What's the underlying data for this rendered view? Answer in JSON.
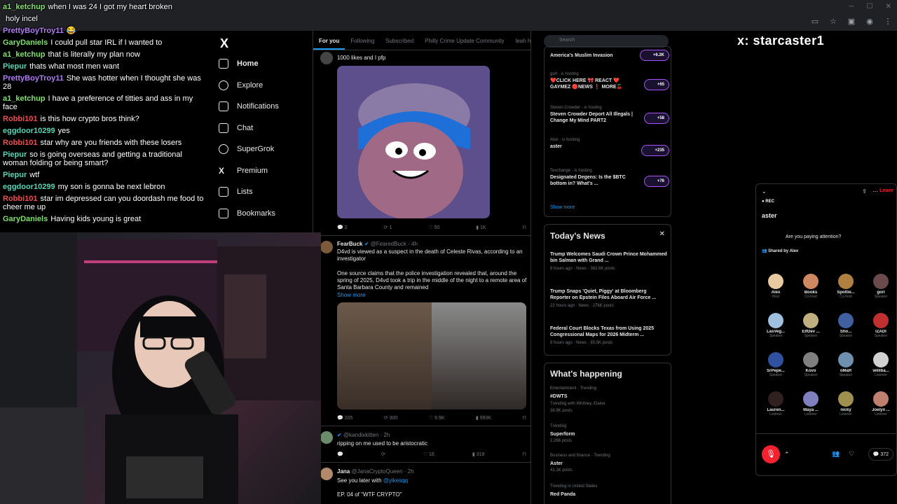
{
  "chat": {
    "messages": [
      {
        "user": "a1_ketchup",
        "color": "#7fe06b",
        "text": "when I was 24 I got my heart broken"
      },
      {
        "user": "",
        "color": "#7fe06b",
        "text": "holy incel"
      },
      {
        "user": "PrettyBoyTroy11",
        "color": "#b07bf5",
        "text": "😂"
      },
      {
        "user": "GaryDaniels",
        "color": "#7fe06b",
        "text": "I could pull star IRL if I wanted to"
      },
      {
        "user": "a1_ketchup",
        "color": "#7fe06b",
        "text": "that is literally my plan now"
      },
      {
        "user": "Piepur",
        "color": "#56d6b8",
        "text": "thats what most men want"
      },
      {
        "user": "PrettyBoyTroy11",
        "color": "#b07bf5",
        "text": "She was hotter when I thought she was 28"
      },
      {
        "user": "a1_ketchup",
        "color": "#7fe06b",
        "text": "I have a preference of titties and ass in my face"
      },
      {
        "user": "Robbi101",
        "color": "#ef4f4f",
        "text": "is this how crypto bros think?"
      },
      {
        "user": "eggdoor10299",
        "color": "#56d6b8",
        "text": "yes"
      },
      {
        "user": "Robbi101",
        "color": "#ef4f4f",
        "text": "star why are you friends with these losers"
      },
      {
        "user": "Piepur",
        "color": "#56d6b8",
        "text": "so is going overseas and getting a traditional woman folding or being smart?"
      },
      {
        "user": "Piepur",
        "color": "#56d6b8",
        "text": "wtf"
      },
      {
        "user": "eggdoor10299",
        "color": "#56d6b8",
        "text": "my son is gonna be next lebron"
      },
      {
        "user": "Robbi101",
        "color": "#ef4f4f",
        "text": "star im depressed can you doordash me food to cheer me up"
      },
      {
        "user": "GaryDaniels",
        "color": "#7fe06b",
        "text": "Having kids young is great"
      }
    ]
  },
  "xnav": {
    "logo": "X",
    "items": [
      {
        "label": "Home",
        "icon": "home-icon"
      },
      {
        "label": "Explore",
        "icon": "search-icon"
      },
      {
        "label": "Notifications",
        "icon": "bell-icon"
      },
      {
        "label": "Chat",
        "icon": "mail-icon"
      },
      {
        "label": "SuperGrok",
        "icon": "grok-icon"
      },
      {
        "label": "Premium",
        "icon": "x-icon"
      },
      {
        "label": "Lists",
        "icon": "list-icon"
      },
      {
        "label": "Bookmarks",
        "icon": "bookmark-icon"
      }
    ]
  },
  "timeline": {
    "tabs": [
      "For you",
      "Following",
      "Subscribed",
      "Philly Crime Update Community",
      "leah h"
    ],
    "post1": {
      "text": "1000 likes and I pfp",
      "replies": "2",
      "reposts": "1",
      "likes": "50",
      "views": "1K"
    },
    "post2": {
      "name": "FearBuck",
      "handle": "@FearedBuck · 4h",
      "text1": "D4vd is viewed as a suspect in the death of Celeste Rivas, according to an investigator",
      "text2": "One source claims that the police investigation revealed that, around the spring of 2025, D4vd took a trip in the middle of the night to a remote area of Santa Barbara County and remained",
      "show_more": "Show more",
      "replies": "205",
      "reposts": "300",
      "likes": "9.9K",
      "views": "993K"
    },
    "post3": {
      "handle": "@kandixkitten · 2h",
      "text": "ripping on me used to be aristocratic",
      "likes": "16",
      "views": "318"
    },
    "post4": {
      "name": "Jana",
      "handle": "@JanaCryptoQueen · 2h",
      "text1": "See you later with",
      "mention": "@yikesqq",
      "text2": "EP. 04 of \"WTF CRYPTO\""
    }
  },
  "trending": {
    "search_placeholder": "Search",
    "spaces": [
      {
        "host": "",
        "title": "America's Muslim Invasion",
        "count": "+6.2K"
      },
      {
        "host": "gorl · is hosting",
        "title": "❤️CLICK HERE 🎀 REACT ❤️ GAYMEZ 🔴NEWS ❗ MORE🍒",
        "count": "+65"
      },
      {
        "host": "Steven Crowder · is hosting",
        "title": "Steven Crowder Deport All Illegals | Change My Mind PART2",
        "count": "+58"
      },
      {
        "host": "Alex · is hosting",
        "title": "aster",
        "count": "+235"
      },
      {
        "host": "Texchange · is hosting",
        "title": "Designated Degens: Is the $BTC bottom in? What's ...",
        "count": "+76"
      }
    ],
    "show_more": "Show more",
    "news_title": "Today's News",
    "news": [
      {
        "title": "Trump Welcomes Saudi Crown Prince Mohammed bin Salman with Grand ...",
        "meta": "9 hours ago · News · 362.6K posts"
      },
      {
        "title": "Trump Snaps 'Quiet, Piggy' at Bloomberg Reporter on Epstein Files Aboard Air Force ...",
        "meta": "22 hours ago · News · 276K posts"
      },
      {
        "title": "Federal Court Blocks Texas from Using 2025 Congressional Maps for 2026 Midterm ...",
        "meta": "8 hours ago · News · 85.5K posts"
      }
    ],
    "happening_title": "What's happening",
    "trends": [
      {
        "context": "Entertainment · Trending",
        "name": "#DWTS",
        "sub": "Trending with Whitney, Elaine",
        "posts": "38.9K posts"
      },
      {
        "context": "Trending",
        "name": "Superform",
        "sub": "",
        "posts": "2,266 posts"
      },
      {
        "context": "Business and finance · Trending",
        "name": "Aster",
        "sub": "",
        "posts": "41.1K posts"
      },
      {
        "context": "Trending in United States",
        "name": "Red Panda",
        "sub": "",
        "posts": ""
      }
    ]
  },
  "brand": "x: starcaster1",
  "space": {
    "leave": "Leave",
    "rec": "● REC",
    "title": "aster",
    "question": "Are you paying attention?",
    "shared": "👥 Shared by Alex",
    "speakers": [
      {
        "name": "Alex",
        "role": "Host",
        "color": "#e8c9a0"
      },
      {
        "name": "Books",
        "role": "Co-host",
        "color": "#d08860"
      },
      {
        "name": "Spottie...",
        "role": "Co-host",
        "color": "#b08040"
      },
      {
        "name": "gorl",
        "role": "Speaker",
        "color": "#6a4a4a"
      },
      {
        "name": "LasVeg...",
        "role": "Speaker",
        "color": "#a0c0e0"
      },
      {
        "name": "ElfDev ...",
        "role": "Speaker",
        "color": "#c0b080"
      },
      {
        "name": "Sho...",
        "role": "Speaker",
        "color": "#4060a0"
      },
      {
        "name": "IZADI",
        "role": "Speaker",
        "color": "#c03030"
      },
      {
        "name": "SrPepe...",
        "role": "Speaker",
        "color": "#3050a0"
      },
      {
        "name": "Kovo",
        "role": "Speaker",
        "color": "#808080"
      },
      {
        "name": "oMaR",
        "role": "Speaker",
        "color": "#7090b0"
      },
      {
        "name": "williba...",
        "role": "Listener",
        "color": "#d0d0d0"
      },
      {
        "name": "Lauren...",
        "role": "Listener",
        "color": "#302020"
      },
      {
        "name": "Maya ...",
        "role": "Listener",
        "color": "#8080c0"
      },
      {
        "name": "nicky",
        "role": "Listener",
        "color": "#a09050"
      },
      {
        "name": "Joelyn ...",
        "role": "Listener",
        "color": "#c08070"
      }
    ],
    "listener_count": "372"
  }
}
